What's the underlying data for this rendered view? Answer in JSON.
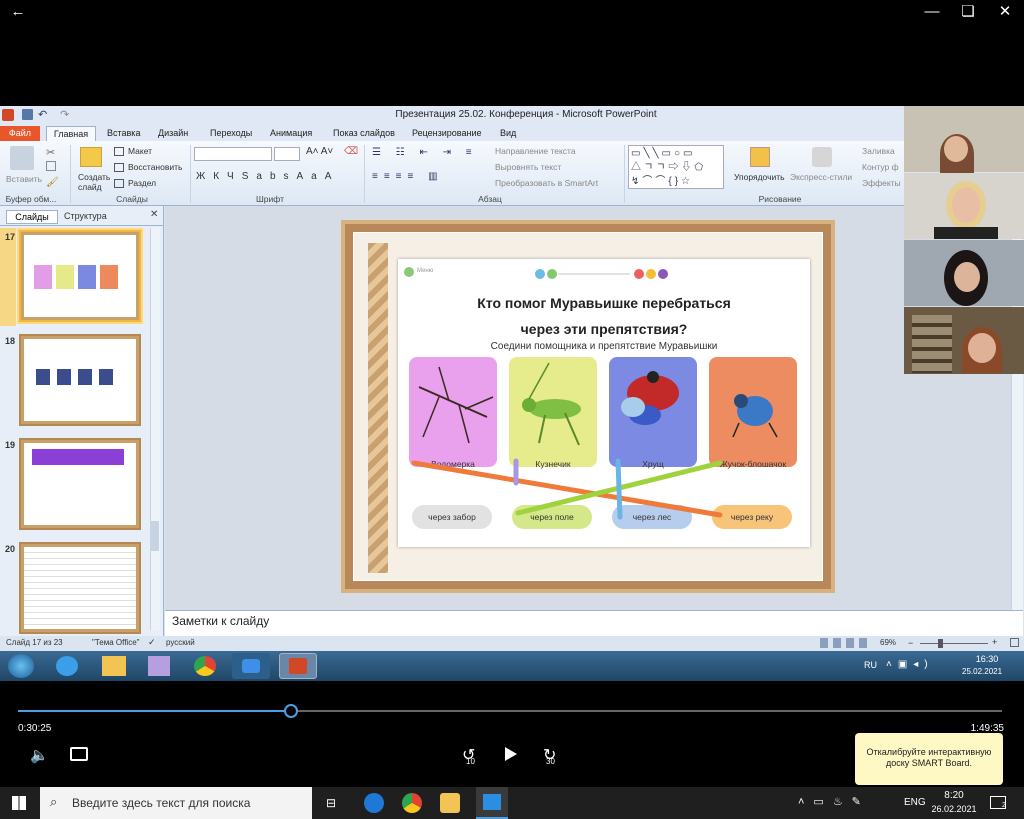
{
  "player": {
    "back_label": "←",
    "elapsed": "0:30:25",
    "total": "1:49:35",
    "rewind": "10",
    "forward": "30",
    "progress": 0.277
  },
  "ppt": {
    "window_title": "Презентация 25.02. Конференция - Microsoft PowerPoint",
    "tabs": [
      "Файл",
      "Главная",
      "Вставка",
      "Дизайн",
      "Переходы",
      "Анимация",
      "Показ слайдов",
      "Рецензирование",
      "Вид"
    ],
    "groups": [
      "Буфер обм...",
      "Слайды",
      "Шрифт",
      "Абзац",
      "Рисование"
    ],
    "ribbon": {
      "paste": "Вставить",
      "new_slide": "Создать слайд",
      "layout": "Макет",
      "reset": "Восстановить",
      "section": "Раздел",
      "text_dir": "Направление текста",
      "align_text": "Выровнять текст",
      "smartart": "Преобразовать в SmartArt",
      "arrange": "Упорядочить",
      "quick_styles": "Экспресс-стили",
      "fill": "Заливка",
      "outline": "Контур ф",
      "effects": "Эффекты"
    },
    "pane_tabs": [
      "Слайды",
      "Структура"
    ],
    "slide_numbers": [
      "17",
      "18",
      "19",
      "20"
    ],
    "slide": {
      "home_label": "Меню",
      "title1": "Кто помог Муравьишке перебраться",
      "title2": "через эти препятствия?",
      "subtitle": "Соедини помощника и препятствие Муравьишки",
      "helpers": [
        "Водомерка",
        "Кузнечик",
        "Хрущ",
        "Жучок-блошачок"
      ],
      "obstacles": [
        "через забор",
        "через поле",
        "через лес",
        "через реку"
      ]
    },
    "notes_placeholder": "Заметки к слайду",
    "status": {
      "slide_of": "Слайд 17 из 23",
      "theme": "\"Тема Office\"",
      "language": "русский",
      "zoom": "69%"
    }
  },
  "win7": {
    "lang": "RU",
    "time": "16:30",
    "date": "25.02.2021"
  },
  "notification": "Откалибруйте интерактивную доску SMART Board.",
  "taskbar": {
    "search_placeholder": "Введите здесь текст для поиска",
    "lang": "ENG",
    "time": "8:20",
    "date": "26.02.2021",
    "notif_count": "2"
  },
  "colors": {
    "ppt_file_tab": "#e8562a",
    "player_accent": "#4aa0e6",
    "notification_bg": "#fdf8c4"
  }
}
